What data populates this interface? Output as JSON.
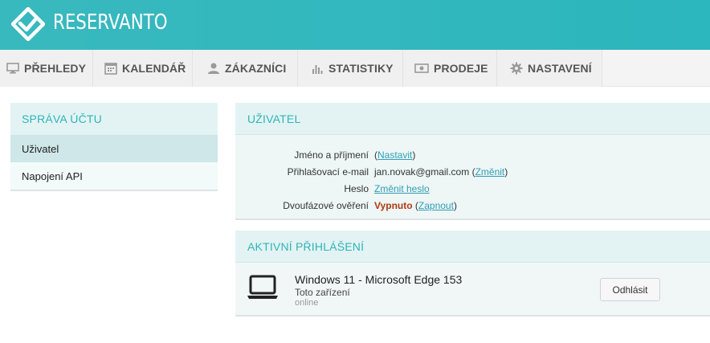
{
  "header": {
    "brand": "RESERVANTO",
    "logo_icon": "reservanto-logo-icon",
    "color": "#2cb6bd"
  },
  "nav": {
    "items": [
      {
        "label": "PŘEHLEDY",
        "icon": "monitor-icon"
      },
      {
        "label": "KALENDÁŘ",
        "icon": "calendar-icon"
      },
      {
        "label": "ZÁKAZNÍCI",
        "icon": "user-icon"
      },
      {
        "label": "STATISTIKY",
        "icon": "bar-chart-icon"
      },
      {
        "label": "PRODEJE",
        "icon": "cash-icon"
      },
      {
        "label": "NASTAVENÍ",
        "icon": "gear-icon"
      }
    ]
  },
  "sidebar": {
    "title": "SPRÁVA ÚČTU",
    "items": [
      {
        "label": "Uživatel",
        "active": true
      },
      {
        "label": "Napojení API",
        "active": false
      }
    ]
  },
  "user": {
    "title": "UŽIVATEL",
    "name_label": "Jméno a příjmení",
    "name_link": "Nastavit",
    "email_label": "Přihlašovací e-mail",
    "email_value": "jan.novak@gmail.com",
    "email_link": "Změnit",
    "password_label": "Heslo",
    "password_link": "Změnit heslo",
    "twofa_label": "Dvoufázové ověření",
    "twofa_status": "Vypnuto",
    "twofa_link": "Zapnout"
  },
  "sessions": {
    "title": "AKTIVNÍ PŘIHLÁŠENÍ",
    "items": [
      {
        "device": "Windows 11 - Microsoft Edge 153",
        "note": "Toto zařízení",
        "status": "online",
        "icon": "laptop-icon",
        "button": "Odhlásit"
      }
    ]
  }
}
